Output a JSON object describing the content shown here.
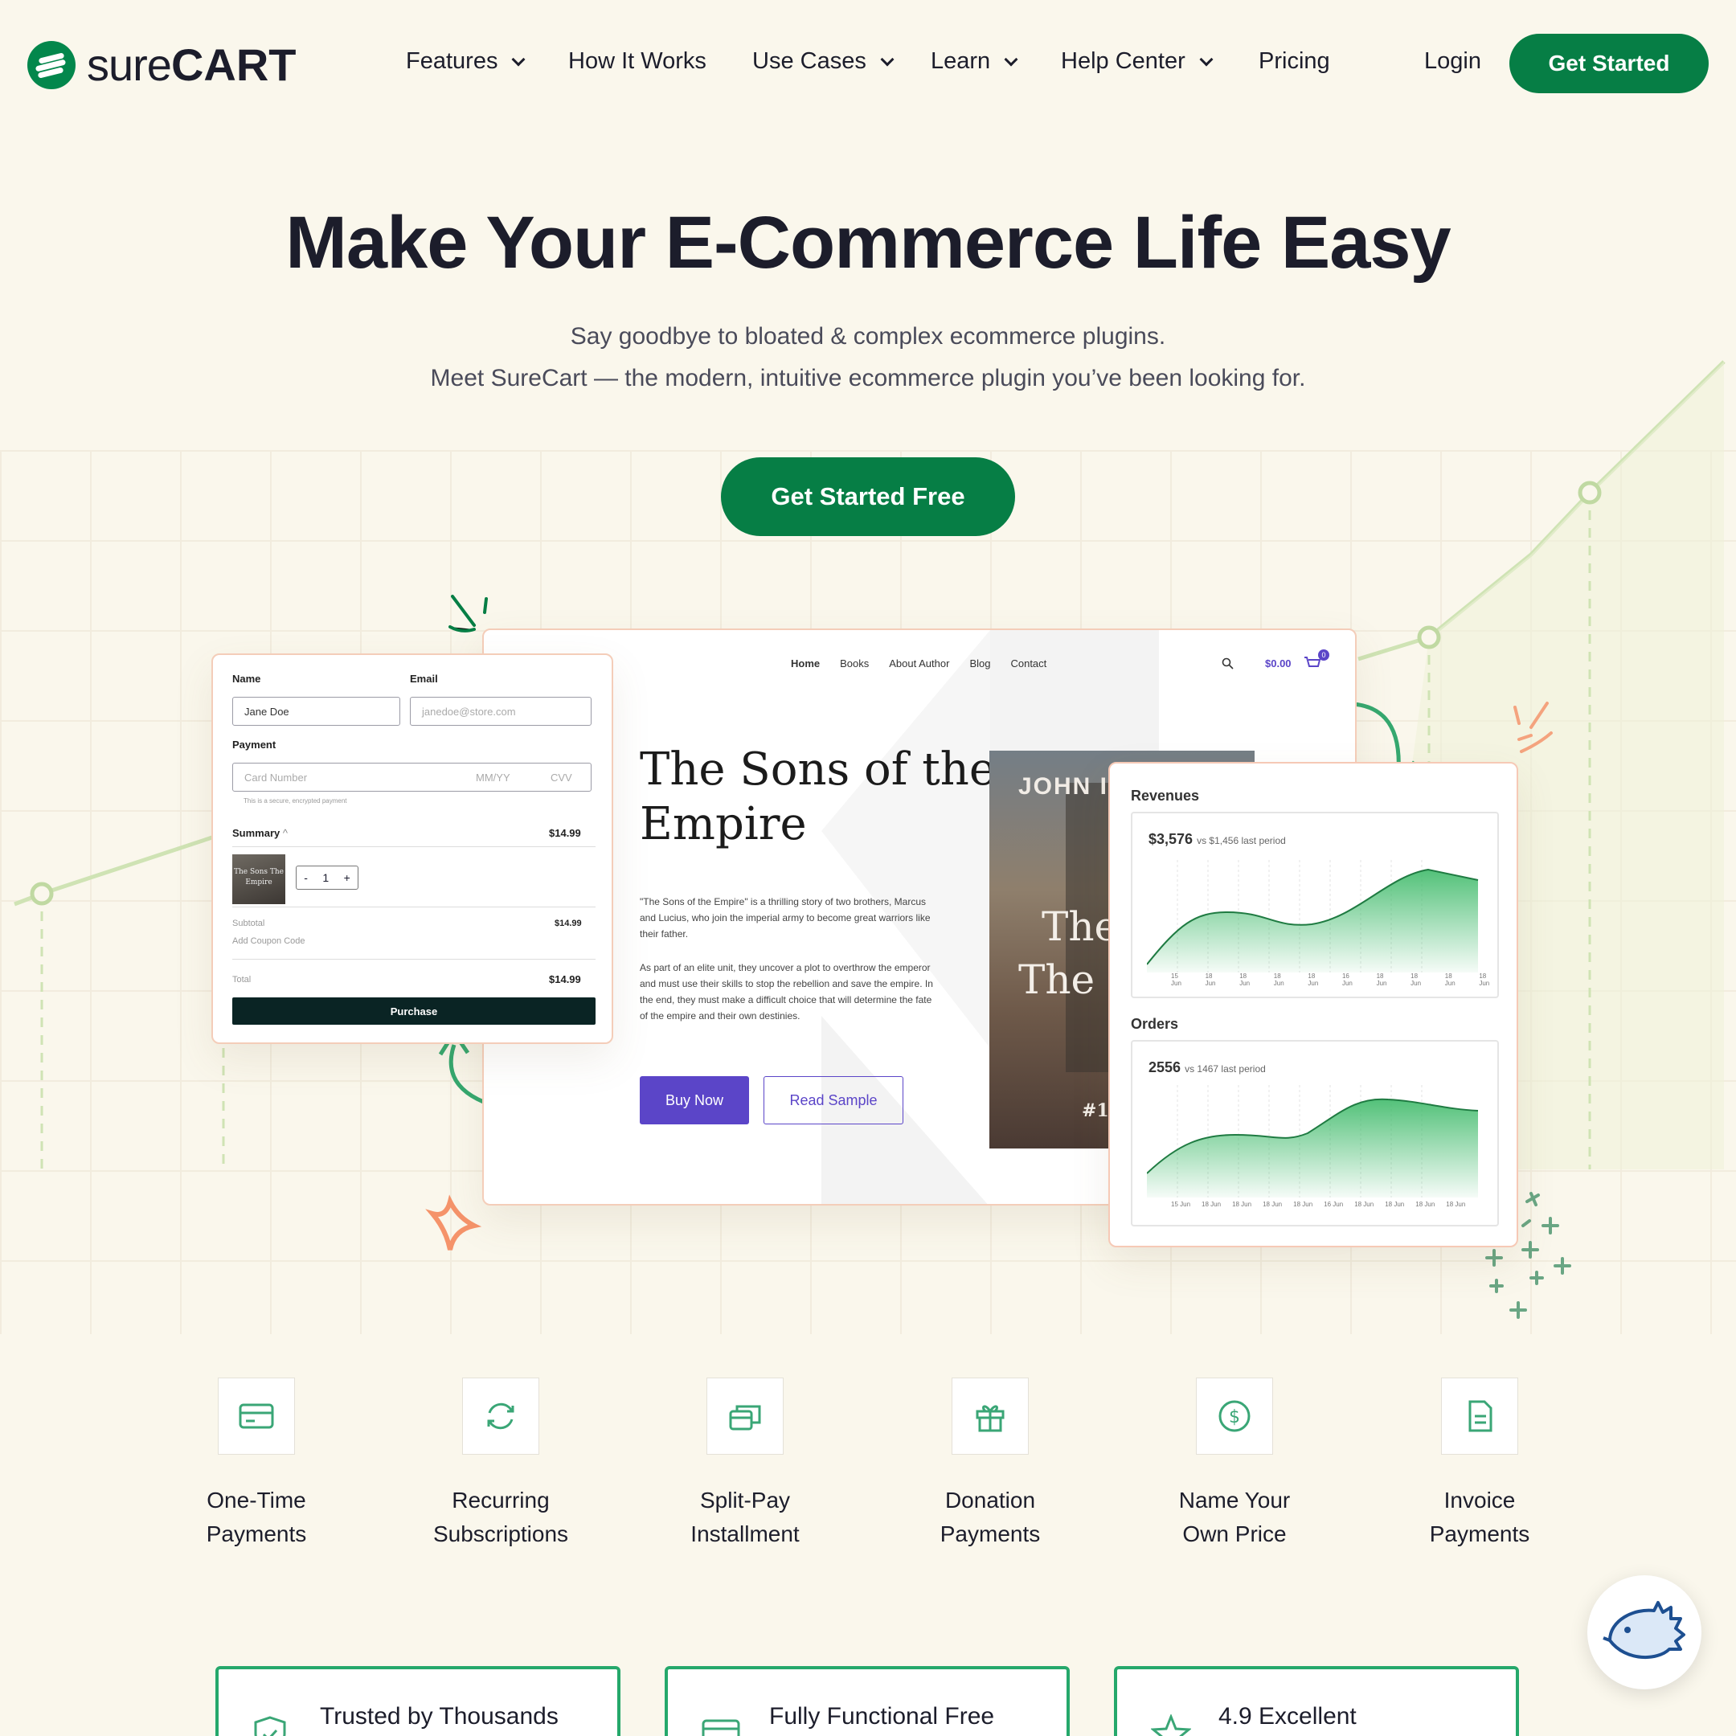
{
  "header": {
    "logo_sure": "sure",
    "logo_cart": "CART",
    "nav": [
      {
        "label": "Features",
        "dropdown": true
      },
      {
        "label": "How It Works",
        "dropdown": false
      },
      {
        "label": "Use Cases",
        "dropdown": true
      },
      {
        "label": "Learn",
        "dropdown": true
      },
      {
        "label": "Help Center",
        "dropdown": true
      },
      {
        "label": "Pricing",
        "dropdown": false
      }
    ],
    "login": "Login",
    "cta": "Get Started"
  },
  "hero": {
    "title": "Make Your E-Commerce Life Easy",
    "subtitle_1": "Say goodbye to bloated & complex ecommerce plugins.",
    "subtitle_2": "Meet SureCart — the modern, intuitive ecommerce plugin you’ve been looking for.",
    "cta": "Get Started Free"
  },
  "checkout": {
    "name_label": "Name",
    "email_label": "Email",
    "name_value": "Jane Doe",
    "email_placeholder": "janedoe@store.com",
    "payment_label": "Payment",
    "card_placeholder": "Card Number",
    "exp_placeholder": "MM/YY",
    "cvv_placeholder": "CVV",
    "secure_note": "This is a secure, encrypted payment",
    "summary_label": "Summary",
    "summary_price": "$14.99",
    "book_thumb": "The Sons The Empire",
    "qty": "1",
    "qty_minus": "-",
    "qty_plus": "+",
    "subtotal_label": "Subtotal",
    "subtotal_value": "$14.99",
    "coupon": "Add Coupon Code",
    "total_label": "Total",
    "total_value": "$14.99",
    "purchase": "Purchase"
  },
  "store": {
    "nav": [
      "Home",
      "Books",
      "About Author",
      "Blog",
      "Contact"
    ],
    "cart_total": "$0.00",
    "cart_count": "0",
    "book_title_1": "The Sons of the",
    "book_title_2": "Empire",
    "desc_1": "\"The Sons of the Empire\" is a thrilling story of two brothers, Marcus and Lucius, who join the imperial army to become great warriors like their father.",
    "desc_2": "As part of an elite unit, they uncover a plot to overthrow the emperor and must use their skills to stop the rebellion and save the empire. In the end, they must make a difficult choice that will determine the fate of the empire and their own destinies.",
    "buy_now": "Buy Now",
    "read_sample": "Read Sample",
    "cover_author": "JOHN I",
    "cover_title_1": "The",
    "cover_title_2": "The I",
    "cover_rank": "#1"
  },
  "dashboard": {
    "revenues_label": "Revenues",
    "revenues_value": "$3,576",
    "revenues_compare": "vs $1,456 last period",
    "orders_label": "Orders",
    "orders_value": "2556",
    "orders_compare": "vs 1467 last period",
    "x_labels": [
      "15 Jun",
      "18 Jun",
      "18 Jun",
      "18 Jun",
      "18 Jun",
      "16 Jun",
      "18 Jun",
      "18 Jun",
      "18 Jun",
      "18 Jun"
    ],
    "accent": "#3fba6a"
  },
  "features": [
    {
      "line1": "One-Time",
      "line2": "Payments",
      "icon": "credit-card-icon"
    },
    {
      "line1": "Recurring",
      "line2": "Subscriptions",
      "icon": "refresh-icon"
    },
    {
      "line1": "Split-Pay",
      "line2": "Installment",
      "icon": "cards-icon"
    },
    {
      "line1": "Donation",
      "line2": "Payments",
      "icon": "gift-icon"
    },
    {
      "line1": "Name Your",
      "line2": "Own Price",
      "icon": "dollar-icon"
    },
    {
      "line1": "Invoice",
      "line2": "Payments",
      "icon": "document-icon"
    }
  ],
  "trust": [
    {
      "label": "Trusted by Thousands",
      "icon": "shield-check-icon"
    },
    {
      "label": "Fully Functional Free",
      "icon": "credit-card-icon"
    },
    {
      "label": "4.9 Excellent",
      "icon": "star-icon"
    }
  ],
  "colors": {
    "brand": "#067e45",
    "purple": "#5b45c8",
    "cream": "#faf7ec"
  }
}
